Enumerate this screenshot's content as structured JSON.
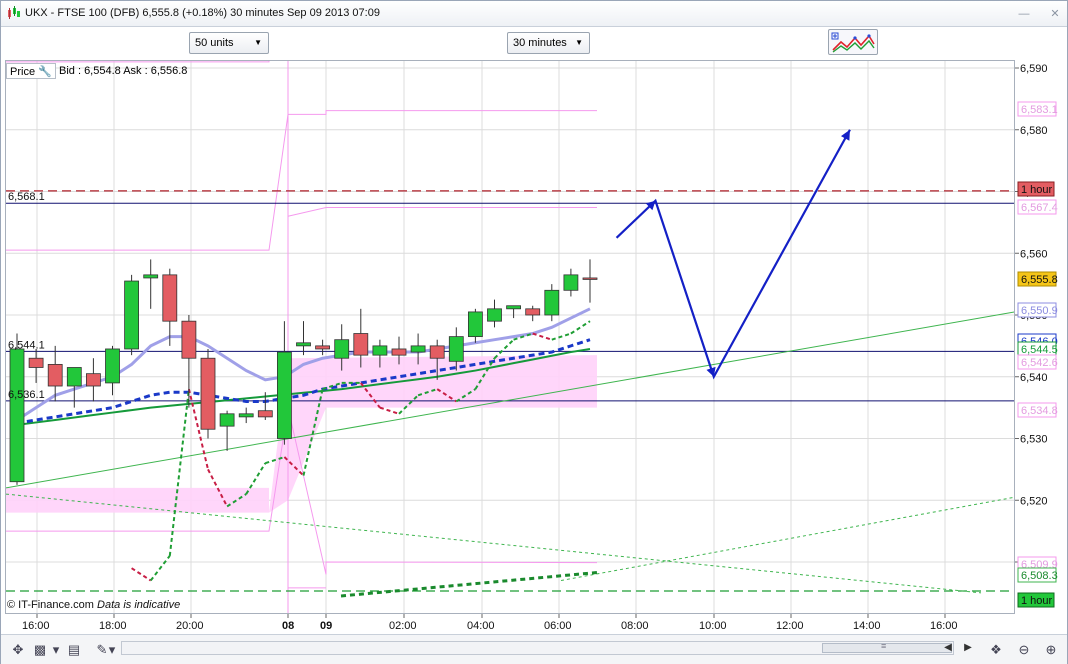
{
  "window": {
    "title": "UKX - FTSE 100 (DFB)    6,555.8 (+0.18%)    30 minutes  Sep 09 2013 07:09",
    "icon": "candlestick-chart-icon"
  },
  "toolbar": {
    "size_value": "50 units",
    "interval_value": "30 minutes",
    "tools_icon": "chart-tools-icon"
  },
  "price_panel": {
    "label": "Price",
    "settings_icon": "wrench-icon",
    "bid_ask": "Bid : 6,554.8  Ask : 6,556.8"
  },
  "footnote": {
    "copyright": "© IT-Finance.com",
    "note": "Data is indicative"
  },
  "colors": {
    "up_candle": "#22c73a",
    "down_candle": "#e35d62",
    "envelope_line": "#f599ee",
    "envelope_fill": "#ffd1f9",
    "sma_fast": "#a0a0e8",
    "sma_dashed": "#1a39c8",
    "sma_slow": "#159a3a",
    "arrow": "#1420c6",
    "hour_line": "#b0202a"
  },
  "chart_data": {
    "type": "candlestick",
    "x_ticks": [
      "16:00",
      "18:00",
      "20:00",
      "08",
      "09",
      "02:00",
      "04:00",
      "06:00",
      "08:00",
      "10:00",
      "12:00",
      "14:00",
      "16:00"
    ],
    "x_tick_bold": [
      false,
      false,
      false,
      true,
      true,
      false,
      false,
      false,
      false,
      false,
      false,
      false,
      false
    ],
    "y_ticks": [
      "6,590",
      "6,580",
      "6,570",
      "6,560",
      "6,550",
      "6,540",
      "6,530",
      "6,520",
      "6,510"
    ],
    "y_tick_values": [
      6590,
      6580,
      6570,
      6560,
      6550,
      6540,
      6530,
      6520,
      6510
    ],
    "ylim": [
      6505.5,
      6592.5
    ],
    "candles": [
      {
        "o": 6523.0,
        "h": 6547.0,
        "l": 6522.5,
        "c": 6544.5
      },
      {
        "o": 6543.0,
        "h": 6544.5,
        "l": 6539.0,
        "c": 6541.5
      },
      {
        "o": 6542.0,
        "h": 6545.0,
        "l": 6536.0,
        "c": 6538.5
      },
      {
        "o": 6538.5,
        "h": 6541.5,
        "l": 6535.0,
        "c": 6541.5
      },
      {
        "o": 6540.5,
        "h": 6543.0,
        "l": 6536.0,
        "c": 6538.5
      },
      {
        "o": 6539.0,
        "h": 6545.0,
        "l": 6537.0,
        "c": 6544.5
      },
      {
        "o": 6544.5,
        "h": 6556.5,
        "l": 6543.5,
        "c": 6555.5
      },
      {
        "o": 6556.0,
        "h": 6559.0,
        "l": 6551.0,
        "c": 6556.5
      },
      {
        "o": 6556.5,
        "h": 6557.5,
        "l": 6545.0,
        "c": 6549.0
      },
      {
        "o": 6549.0,
        "h": 6550.0,
        "l": 6535.0,
        "c": 6543.0
      },
      {
        "o": 6543.0,
        "h": 6544.5,
        "l": 6530.0,
        "c": 6531.5
      },
      {
        "o": 6532.0,
        "h": 6534.5,
        "l": 6528.0,
        "c": 6534.0
      },
      {
        "o": 6533.5,
        "h": 6535.0,
        "l": 6532.5,
        "c": 6534.0
      },
      {
        "o": 6534.5,
        "h": 6537.5,
        "l": 6533.0,
        "c": 6533.5
      },
      {
        "o": 6530.0,
        "h": 6549.0,
        "l": 6529.0,
        "c": 6544.0
      },
      {
        "o": 6545.0,
        "h": 6549.0,
        "l": 6543.5,
        "c": 6545.5
      },
      {
        "o": 6545.0,
        "h": 6546.0,
        "l": 6543.5,
        "c": 6544.5
      },
      {
        "o": 6543.0,
        "h": 6548.5,
        "l": 6541.0,
        "c": 6546.0
      },
      {
        "o": 6547.0,
        "h": 6551.0,
        "l": 6541.5,
        "c": 6543.5
      },
      {
        "o": 6543.5,
        "h": 6546.0,
        "l": 6541.5,
        "c": 6545.0
      },
      {
        "o": 6544.5,
        "h": 6546.5,
        "l": 6542.0,
        "c": 6543.5
      },
      {
        "o": 6544.0,
        "h": 6547.0,
        "l": 6542.0,
        "c": 6545.0
      },
      {
        "o": 6545.0,
        "h": 6546.0,
        "l": 6539.5,
        "c": 6543.0
      },
      {
        "o": 6542.5,
        "h": 6548.0,
        "l": 6541.0,
        "c": 6546.5
      },
      {
        "o": 6546.5,
        "h": 6551.0,
        "l": 6545.5,
        "c": 6550.5
      },
      {
        "o": 6549.0,
        "h": 6552.5,
        "l": 6548.0,
        "c": 6551.0
      },
      {
        "o": 6551.0,
        "h": 6551.5,
        "l": 6549.5,
        "c": 6551.5
      },
      {
        "o": 6551.0,
        "h": 6551.5,
        "l": 6549.0,
        "c": 6550.0
      },
      {
        "o": 6550.0,
        "h": 6555.0,
        "l": 6549.0,
        "c": 6554.0
      },
      {
        "o": 6554.0,
        "h": 6557.5,
        "l": 6553.0,
        "c": 6556.5
      },
      {
        "o": 6556.0,
        "h": 6559.0,
        "l": 6552.0,
        "c": 6555.8
      }
    ],
    "envelope": {
      "upper_before": 6591.0,
      "lower_before": 6560.5,
      "upper_day": 6582.3,
      "lower_day": 6551.5,
      "upper_mid": 6568.5,
      "lower_mid": 6510.0,
      "band_before": [
        6522.0,
        6518.0
      ],
      "band_day": [
        6543.5,
        6535.0
      ]
    },
    "sma_fast": [
      6533,
      6535,
      6537,
      6538,
      6539,
      6540,
      6542,
      6545,
      6546.5,
      6546.5,
      6545,
      6543,
      6541,
      6539.5,
      6540,
      6542,
      6543,
      6543.5,
      6544,
      6544,
      6544,
      6544,
      6544.5,
      6545,
      6545.5,
      6546,
      6546.5,
      6547,
      6548,
      6549.5,
      6551
    ],
    "sma_dashed": [
      6532.5,
      6533.0,
      6533.5,
      6534,
      6534.5,
      6535,
      6536,
      6537,
      6537.5,
      6537.5,
      6537,
      6536.5,
      6536,
      6536,
      6536.5,
      6537,
      6538,
      6538.5,
      6539,
      6539.5,
      6540,
      6540.5,
      6541,
      6541.5,
      6542,
      6542.5,
      6543,
      6543.5,
      6544,
      6545,
      6546
    ],
    "sma_slow": [
      6532.2,
      6532.6,
      6533,
      6533.4,
      6533.8,
      6534.2,
      6534.6,
      6535,
      6535.3,
      6535.6,
      6535.9,
      6536.2,
      6536.5,
      6536.8,
      6537.1,
      6537.4,
      6537.7,
      6538,
      6538.4,
      6538.8,
      6539.2,
      6539.6,
      6540,
      6540.5,
      6541,
      6541.6,
      6542.2,
      6542.8,
      6543.4,
      6544,
      6544.5
    ],
    "indicator_dashed": [
      null,
      null,
      null,
      null,
      null,
      null,
      6509,
      6507,
      6511,
      6538,
      6525,
      6519,
      6521,
      6526,
      6527,
      6524,
      6538,
      6539,
      6539,
      6535,
      6534,
      6537,
      6538,
      6536,
      6538,
      6543,
      6546,
      6547,
      6546,
      6547,
      6549
    ],
    "horizontal_lines": [
      {
        "value": 6568.1,
        "label": "6,568.1"
      },
      {
        "value": 6544.1,
        "label": "6,544.1"
      },
      {
        "value": 6536.1,
        "label": "6,536.1"
      }
    ],
    "hour_levels": [
      {
        "value": 6570.1,
        "label": "1 hour"
      },
      {
        "value": 6505.5,
        "label": "1 hour"
      }
    ],
    "right_labels": [
      {
        "value": 6583.1,
        "label": "6,583.1"
      },
      {
        "value": 6567.4,
        "label": "6,567.4"
      },
      {
        "value": 6555.8,
        "label": "6,555.8"
      },
      {
        "value": 6550.9,
        "label": "6,550.9"
      },
      {
        "value": 6546.0,
        "label": "6,546.0"
      },
      {
        "value": 6544.5,
        "label": "6,544.5"
      },
      {
        "value": 6542.6,
        "label": "6,542.6"
      },
      {
        "value": 6534.8,
        "label": "6,534.8"
      },
      {
        "value": 6509.9,
        "label": "6,509.9"
      },
      {
        "value": 6508.3,
        "label": "6,508.3"
      }
    ],
    "projection_arrow": [
      {
        "time": "07:30",
        "price": 6562.5
      },
      {
        "time": "08:30",
        "price": 6568.5
      },
      {
        "time": "10:00",
        "price": 6540.0
      },
      {
        "time": "13:30",
        "price": 6580.0
      }
    ],
    "grid": true
  },
  "bottom": {
    "icons": [
      "move-icon",
      "bar-type-icon",
      "chart-style-icon",
      "indicator-icon",
      "draw-icon",
      "layout-icon"
    ],
    "scroll_grip": "≡",
    "zoom_icons": [
      "scroll-left-icon",
      "scroll-right-icon",
      "fit-icon",
      "zoom-out-icon",
      "zoom-in-icon"
    ]
  }
}
